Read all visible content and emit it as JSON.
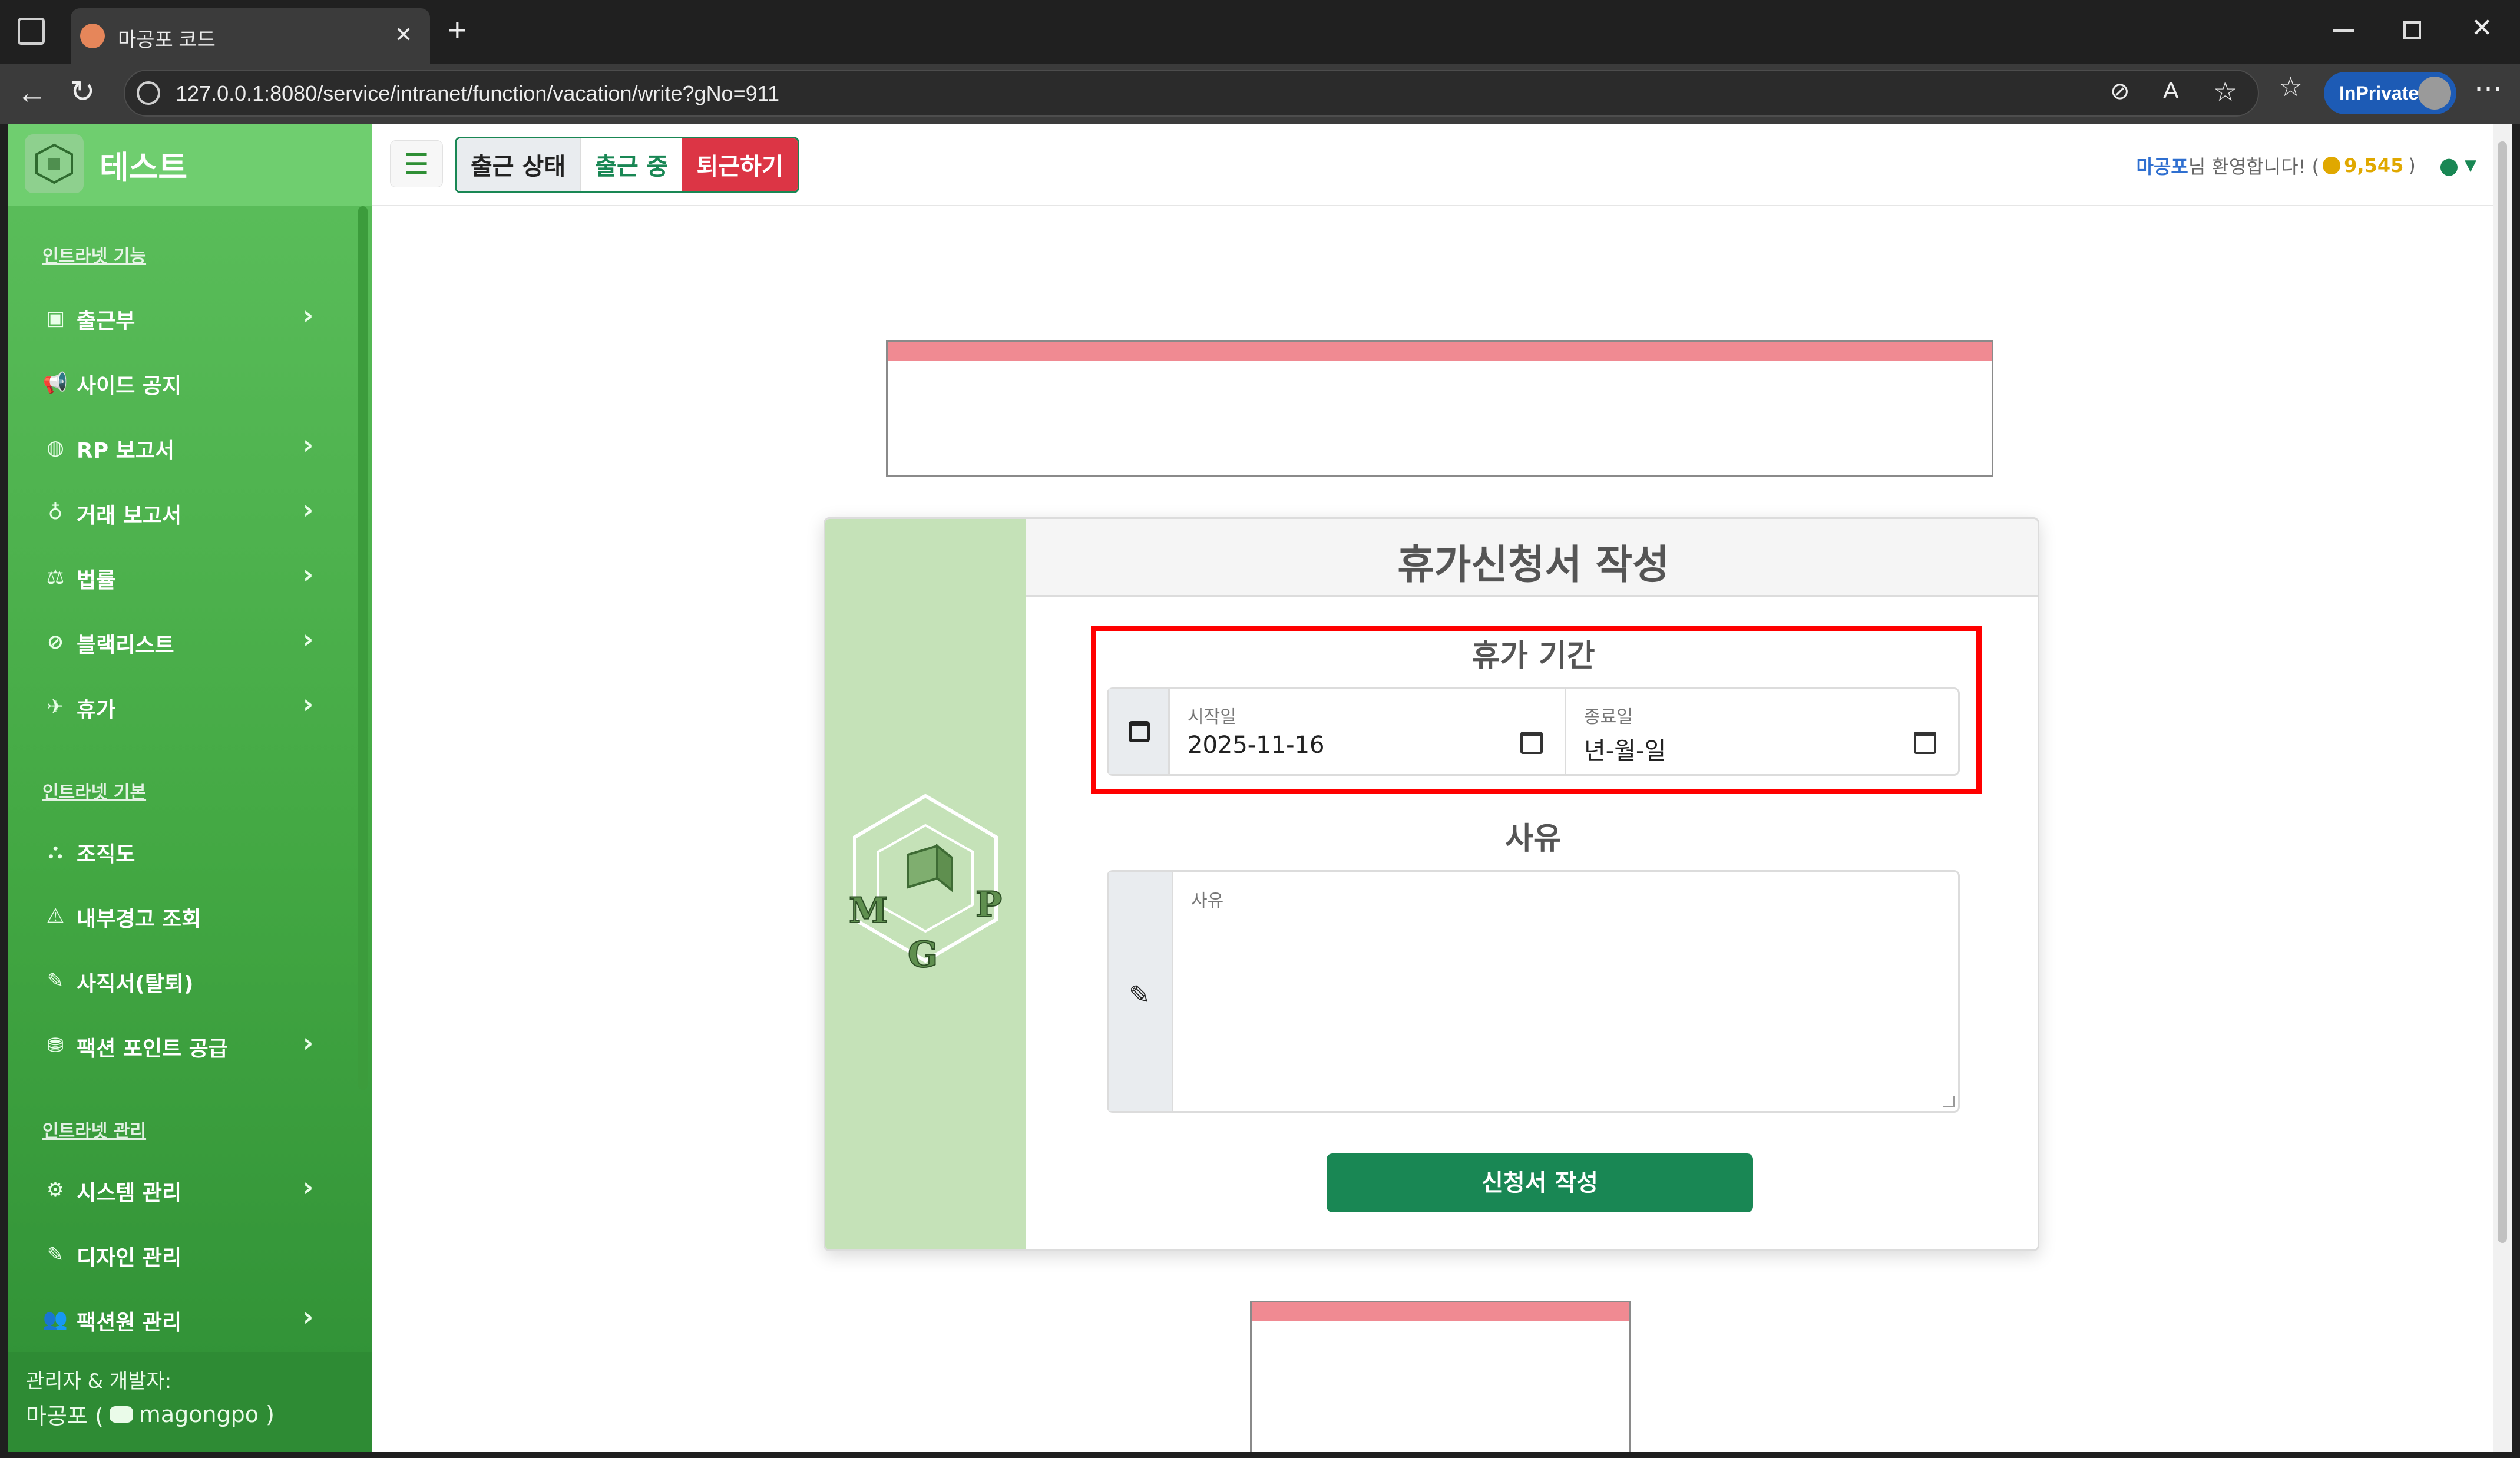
{
  "browser": {
    "tab_title": "마공포 코드",
    "url": "127.0.0.1:8080/service/intranet/function/vacation/write?gNo=911",
    "inprivate_label": "InPrivate",
    "new_tab_symbol": "+",
    "tab_close_symbol": "✕"
  },
  "sidebar": {
    "brand": "테스트",
    "sections": [
      {
        "title": "인트라넷 기능",
        "items": [
          {
            "label": "출근부",
            "icon": "book-icon",
            "glyph": "▣",
            "chevron": true
          },
          {
            "label": "사이드 공지",
            "icon": "megaphone-icon",
            "glyph": "📢",
            "chevron": false
          },
          {
            "label": "RP 보고서",
            "icon": "gamepad-icon",
            "glyph": "◍",
            "chevron": true
          },
          {
            "label": "거래 보고서",
            "icon": "moneybag-icon",
            "glyph": "♁",
            "chevron": true
          },
          {
            "label": "법률",
            "icon": "scale-icon",
            "glyph": "⚖",
            "chevron": true
          },
          {
            "label": "블랙리스트",
            "icon": "ban-icon",
            "glyph": "⊘",
            "chevron": true
          },
          {
            "label": "휴가",
            "icon": "plane-icon",
            "glyph": "✈",
            "chevron": true
          }
        ]
      },
      {
        "title": "인트라넷 기본",
        "items": [
          {
            "label": "조직도",
            "icon": "sitemap-icon",
            "glyph": "⛬",
            "chevron": false
          },
          {
            "label": "내부경고 조회",
            "icon": "warning-icon",
            "glyph": "⚠",
            "chevron": false
          },
          {
            "label": "사직서(탈퇴)",
            "icon": "pen-icon",
            "glyph": "✎",
            "chevron": false
          },
          {
            "label": "팩션 포인트 공급",
            "icon": "coins-icon",
            "glyph": "⛃",
            "chevron": true
          }
        ]
      },
      {
        "title": "인트라넷 관리",
        "items": [
          {
            "label": "시스템 관리",
            "icon": "gear-icon",
            "glyph": "⚙",
            "chevron": true
          },
          {
            "label": "디자인 관리",
            "icon": "pen-icon",
            "glyph": "✎",
            "chevron": false
          },
          {
            "label": "팩션원 관리",
            "icon": "users-icon",
            "glyph": "👥",
            "chevron": true
          }
        ]
      }
    ],
    "footer": {
      "line1": "관리자 & 개발자:",
      "name": "마공포 (",
      "handle": "magongpo )"
    }
  },
  "header": {
    "attendance_status": "출근 상태",
    "attendance_current": "출근 중",
    "leave_button": "퇴근하기",
    "welcome_name": "마공포",
    "welcome_suffix": "님 환영합니다! (",
    "points": "9,545",
    "points_close": ")",
    "menu_symbol": "☰"
  },
  "form": {
    "title": "휴가신청서 작성",
    "period_title": "휴가 기간",
    "start_label": "시작일",
    "start_value": "2025-11-16",
    "end_label": "종료일",
    "end_value": "년-월-일",
    "reason_title": "사유",
    "reason_placeholder": "사유",
    "submit_label": "신청서 작성"
  },
  "colors": {
    "sidebar_green": "#43a843",
    "primary_green": "#198754",
    "danger_red": "#dc3545",
    "highlight_red": "#ff0000",
    "pink_bar": "#f08a92",
    "card_side": "#c5e2b8"
  }
}
